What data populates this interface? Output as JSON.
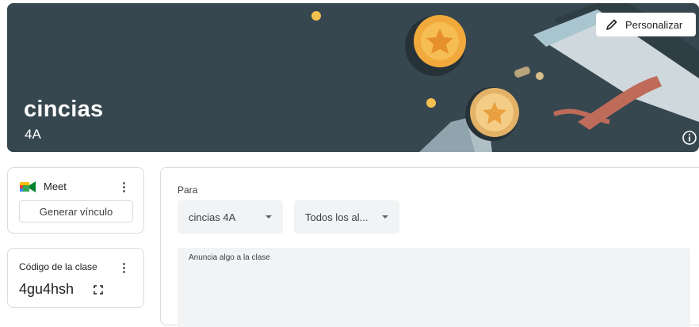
{
  "banner": {
    "title": "cincias",
    "section": "4A",
    "customize_label": "Personalizar",
    "bg_color": "#37474f"
  },
  "meet": {
    "label": "Meet",
    "generate_link_label": "Generar vínculo"
  },
  "class_code": {
    "label": "Código de la clase",
    "value": "4gu4hsh"
  },
  "stream": {
    "for_label": "Para",
    "class_select_value": "cincias 4A",
    "students_select_value": "Todos los al...",
    "announce_placeholder": "Anuncia algo a la clase"
  },
  "icons": {
    "customize": "pencil-icon",
    "info": "info-icon",
    "meet": "meet-logo-icon",
    "menu": "more-vert-icon",
    "expand": "fullscreen-icon",
    "dropdown": "chevron-down-icon"
  }
}
